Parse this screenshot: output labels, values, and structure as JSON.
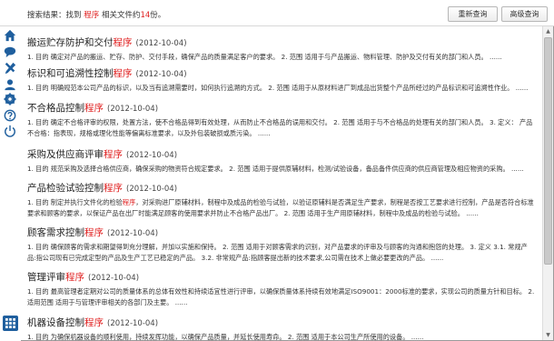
{
  "header": {
    "summary_prefix": "搜索结果：找到",
    "keyword": "程序",
    "summary_mid": "相关文件约",
    "count": "14",
    "summary_suffix": "份。",
    "requery_label": "重新查询",
    "advanced_label": "高级查询"
  },
  "sidebar": {
    "icons": [
      "home-icon",
      "chat-icon",
      "tools-icon",
      "user-icon",
      "gear-icon",
      "help-icon",
      "power-icon"
    ]
  },
  "results": [
    {
      "title_pre": "搬运贮存防护和交付",
      "title_kw": "程序",
      "date": "(2012-10-04)",
      "desc": "1. 目的 确定对产品的搬运、贮存、防护、交付手段，确保产品的质量满足客户的要求。 2. 范围 适用于与产品搬运、物料管理、防护及交付有关的部门和人员。 ......"
    },
    {
      "title_pre": "标识和可追溯性控制",
      "title_kw": "程序",
      "date": "(2012-10-04)",
      "desc": "1. 目的 明确规范本公司产品的标识，以及当有追溯需要时，如何执行追溯的方式。 2. 范围 适用于从原材料进厂到成品出货整个产品所经过的产品标识和可追溯性作业。 ......"
    },
    {
      "title_pre": "不合格品控制",
      "title_kw": "程序",
      "date": "(2012-10-04)",
      "desc": "1. 目的 确定不合格评审的权限，处置方法，使不合格品得到有效处理，从而防止不合格品的误用和交付。 2. 范围 适用于与不合格品的处理有关的部门和人员。 3. 定义： 产品不合格：指表现，规格或理化性能等偏离标准要求，以及外包装破损或质污染。 ......"
    },
    {
      "title_pre": "采购及供应商评审",
      "title_kw": "程序",
      "date": "(2012-10-04)",
      "desc": "1. 目的 规范采购及选择合格供应商，确保采购的物资符合规定要求。 2. 范围 适用于提供原辅材料，检测/试验设备，备品备件供应商的供应商管理及相应物资的采购。 ......"
    },
    {
      "title_pre": "产品检验试验控制",
      "title_kw": "程序",
      "date": "(2012-10-04)",
      "desc": "1. 目的 制定并执行文件化的检验",
      "desc_kw": "程序",
      "desc_rest": "，对采购进厂原辅材料，制程中及成品的检验与试验，以验证原辅料是否满足生产要求，制程是否按工艺要求进行控制，产品是否符合标准要求和顾客的要求，以保证产品在出厂时能满足顾客的使用要求并防止不合格产品出厂。 2. 范围 适用于生产用原辅材料，制程中及成品的检验与试验。 ......"
    },
    {
      "title_pre": "顾客需求控制",
      "title_kw": "程序",
      "date": "(2012-10-04)",
      "desc": "1. 目的 确保顾客的需求和期望得到充分理解，并加以实施和保持。 2. 范围 适用于对顾客需求的识别，对产品要求的评审及与顾客的沟通和抱怨的处理。 3. 定义 3.1. 常规产品:指公司现有已完成定型的产品及生产工艺已稳定的产品。 3.2. 非常规产品:指顾客提出新的技术要求,公司需在技术上做必要更改的产品。 ......"
    },
    {
      "title_pre": "管理评审",
      "title_kw": "程序",
      "date": "(2012-10-04)",
      "desc": "1. 目的 最高管理者定期对公司的质量体系的总体有效性和持续适宜性进行评审，以确保质量体系持续有效地满足ISO9001：2000标准的要求，实现公司的质量方针和目标。 2. 适用范围 适用于与管理评审相关的各部门及主要。 ......"
    },
    {
      "title_pre": "机器设备控制",
      "title_kw": "程序",
      "date": "(2012-10-04)",
      "desc": "1. 目的 为确保机器设备的顺利使用，持续发挥功能，以确保产品质量，并延长使用寿命。 2. 范围 适用于本公司生产所使用的设备。 ......"
    }
  ],
  "colors": {
    "highlight": "#e02020",
    "sidebar_icon": "#1f5f9e",
    "grid_button": "#1f5f9e"
  }
}
